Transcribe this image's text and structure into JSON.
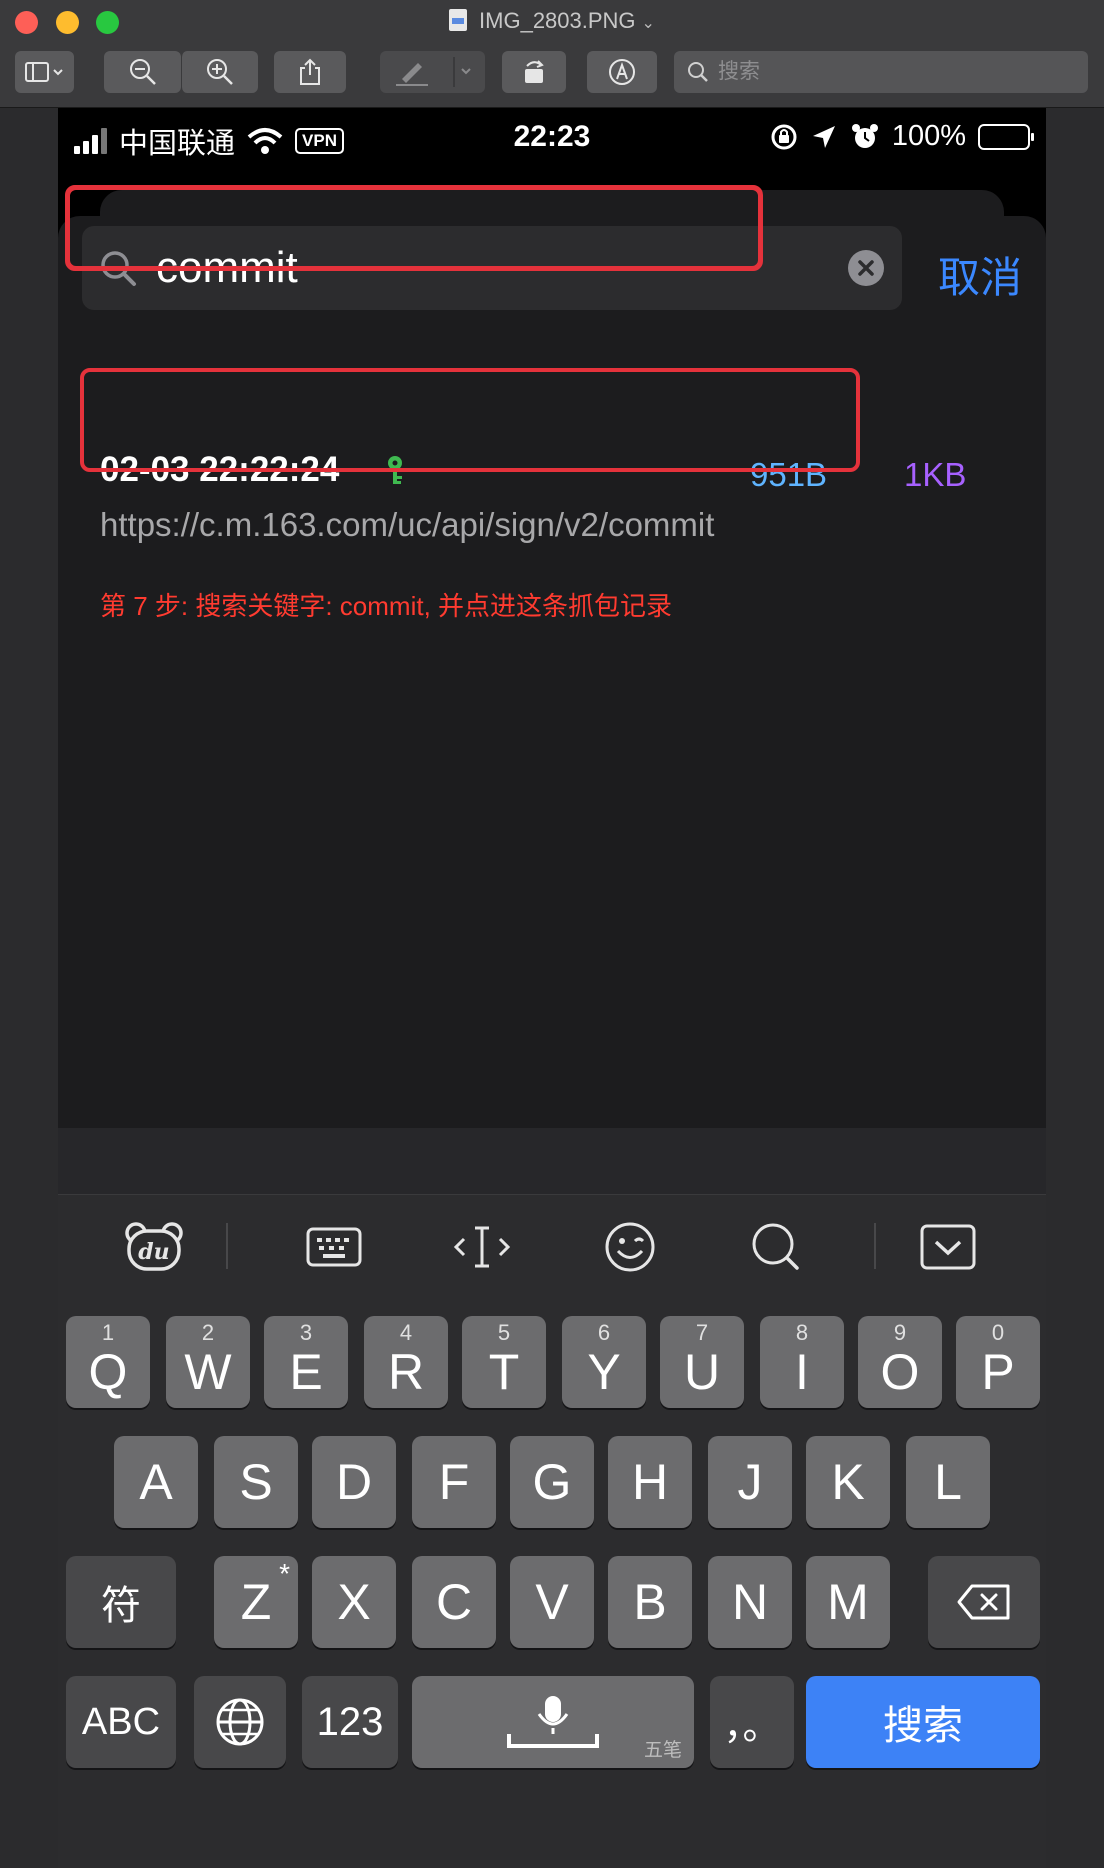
{
  "window": {
    "title": "IMG_2803.PNG",
    "search_placeholder": "搜索"
  },
  "statusbar": {
    "carrier": "中国联通",
    "vpn": "VPN",
    "time": "22:23",
    "battery": "100%"
  },
  "search": {
    "query": "commit",
    "cancel_label": "取消"
  },
  "result": {
    "time": "02-03 22:22:24",
    "request_size": "951B",
    "response_size": "1KB",
    "url": "https://c.m.163.com/uc/api/sign/v2/commit"
  },
  "annotation": "第 7 步: 搜索关键字: commit, 并点进这条抓包记录",
  "keyboard": {
    "row1": [
      {
        "label": "Q",
        "hint": "1"
      },
      {
        "label": "W",
        "hint": "2"
      },
      {
        "label": "E",
        "hint": "3"
      },
      {
        "label": "R",
        "hint": "4"
      },
      {
        "label": "T",
        "hint": "5"
      },
      {
        "label": "Y",
        "hint": "6"
      },
      {
        "label": "U",
        "hint": "7"
      },
      {
        "label": "I",
        "hint": "8"
      },
      {
        "label": "O",
        "hint": "9"
      },
      {
        "label": "P",
        "hint": "0"
      }
    ],
    "row2": [
      "A",
      "S",
      "D",
      "F",
      "G",
      "H",
      "J",
      "K",
      "L"
    ],
    "row3": [
      "Z",
      "X",
      "C",
      "V",
      "B",
      "N",
      "M"
    ],
    "symbols": "符",
    "abc": "ABC",
    "num": "123",
    "space_sub": "五笔",
    "punct": "，。",
    "search_key": "搜索",
    "z_star": "*"
  },
  "colors": {
    "accent_blue": "#3b88ff",
    "highlight_red": "#e5323b",
    "request_size": "#5fb4ff",
    "response_size": "#a761ff"
  }
}
